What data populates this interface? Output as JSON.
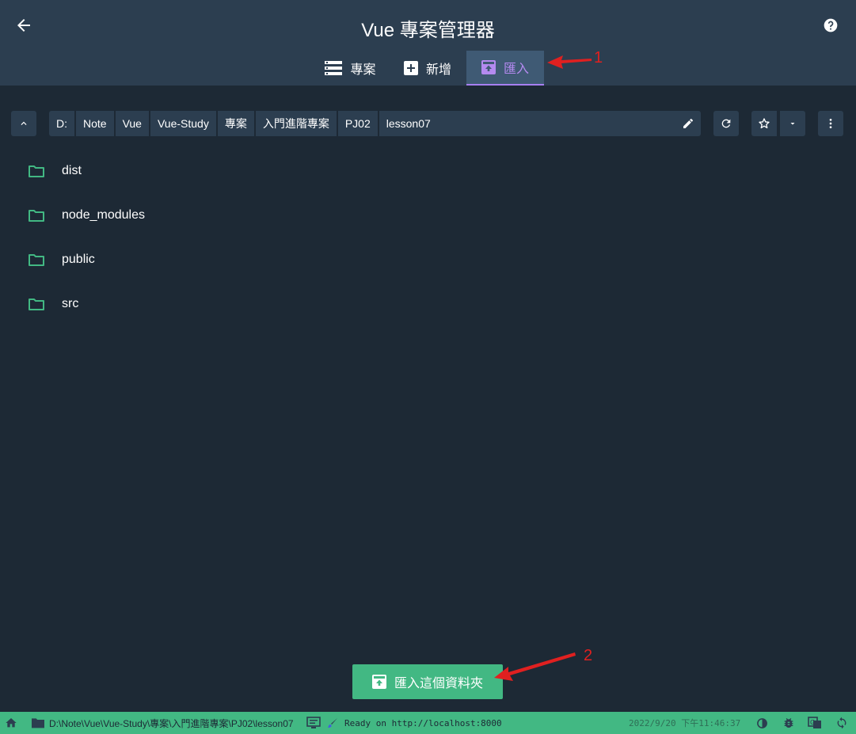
{
  "header": {
    "title": "Vue 專案管理器",
    "icons": {
      "back": "arrow-left-icon",
      "help": "help-circle-icon"
    },
    "tabs": [
      {
        "label": "專案",
        "icon": "list-icon",
        "active": false
      },
      {
        "label": "新增",
        "icon": "plus-box-icon",
        "active": false
      },
      {
        "label": "匯入",
        "icon": "import-box-icon",
        "active": true
      }
    ]
  },
  "breadcrumb": [
    "D:",
    "Note",
    "Vue",
    "Vue-Study",
    "專案",
    "入門進階專案",
    "PJ02",
    "lesson07"
  ],
  "folders": [
    "dist",
    "node_modules",
    "public",
    "src"
  ],
  "import_button": {
    "label": "匯入這個資料夾"
  },
  "annotations": {
    "one": "1",
    "two": "2"
  },
  "statusbar": {
    "path": "D:\\Note\\Vue\\Vue-Study\\專案\\入門進階專案\\PJ02\\lesson07",
    "status": "Ready on http://localhost:8000",
    "timestamp": "2022/9/20 下午11:46:37"
  },
  "colors": {
    "accent": "#42b883",
    "header": "#2c3e50",
    "background": "#1d2935",
    "active_tab": "#b48af0",
    "annotation": "#e02020"
  }
}
